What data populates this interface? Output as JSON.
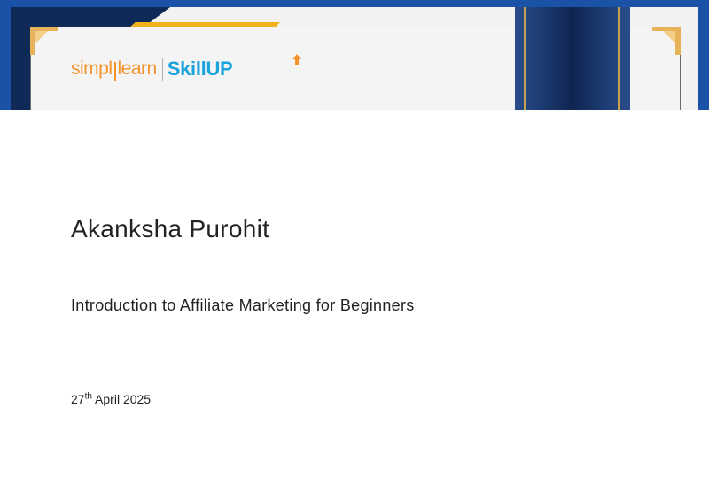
{
  "certificate": {
    "brand": {
      "simpli": "simpl",
      "learn": "learn",
      "skillup": "SkillUP"
    },
    "recipient_name": "Akanksha Purohit",
    "course_title": "Introduction to Affiliate Marketing for Beginners",
    "date": {
      "day": "27",
      "suffix": "th",
      "month_year": "April 2025"
    }
  },
  "colors": {
    "border_blue": "#1a52a8",
    "navy": "#102a58",
    "gold": "#f1b21f",
    "brand_orange": "#f5922a",
    "brand_blue": "#1aa3dc",
    "text": "#222222"
  }
}
